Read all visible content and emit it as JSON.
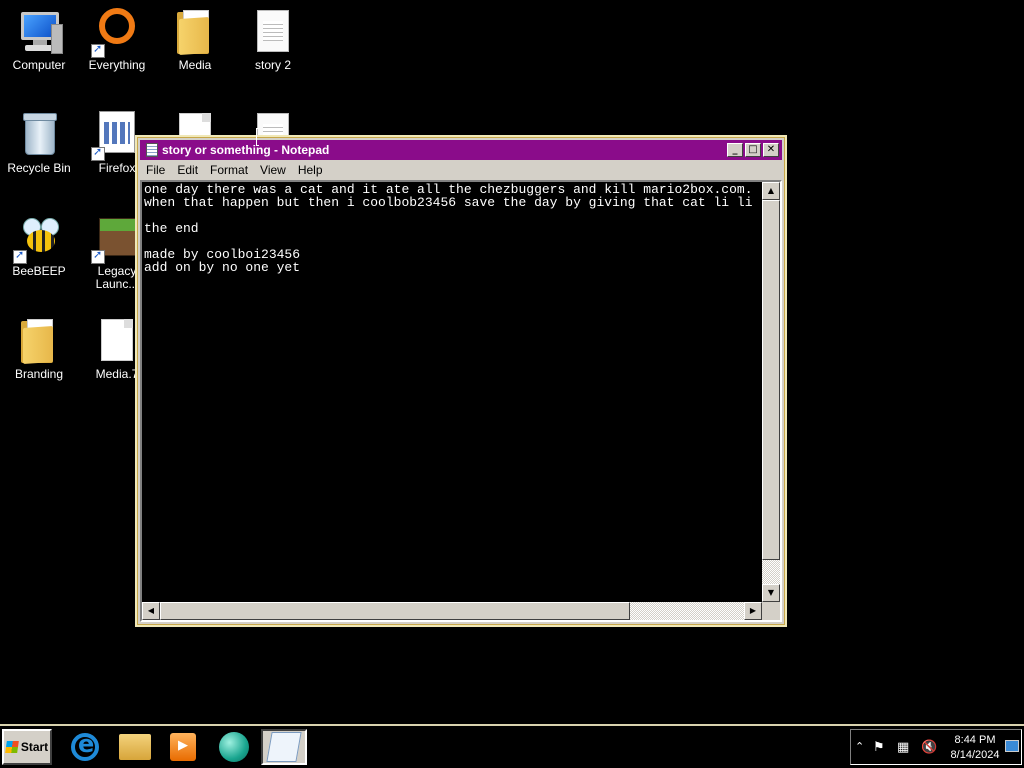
{
  "desktop": {
    "icons": [
      {
        "label": "Computer",
        "icon": "computer-icon"
      },
      {
        "label": "Everything",
        "icon": "everything-icon"
      },
      {
        "label": "Media",
        "icon": "folder-icon"
      },
      {
        "label": "story 2",
        "icon": "text-document-icon"
      },
      {
        "label": "Recycle Bin",
        "icon": "recycle-bin-icon"
      },
      {
        "label": "Firefox",
        "icon": "firefox-shortcut-icon"
      },
      {
        "label": "BeeBEEP",
        "icon": "beebeep-icon"
      },
      {
        "label": "Legacy Launc...",
        "icon": "minecraft-grass-block-icon"
      },
      {
        "label": "Branding",
        "icon": "folder-icon"
      },
      {
        "label": "Media.7",
        "icon": "blank-file-icon"
      }
    ]
  },
  "notepad": {
    "title": "story or something - Notepad",
    "menu": [
      "File",
      "Edit",
      "Format",
      "View",
      "Help"
    ],
    "buttons": {
      "minimize": "_",
      "maximize": "□",
      "close": "✕"
    },
    "content": "one day there was a cat and it ate all the chezbuggers and kill mario2box.com.\nwhen that happen but then i coolbob23456 save the day by giving that cat li li\n\nthe end\n\nmade by coolboi23456\nadd on by no one yet",
    "colors": {
      "titlebar": "#8a0c8a",
      "editor_bg": "#000000",
      "editor_text": "#ffffff"
    }
  },
  "taskbar": {
    "start_label": "Start",
    "pinned": [
      {
        "name": "internet-explorer",
        "icon": "internet-explorer-icon"
      },
      {
        "name": "file-explorer",
        "icon": "folder-icon"
      },
      {
        "name": "media-player",
        "icon": "media-player-icon"
      },
      {
        "name": "teal-app",
        "icon": "teal-globe-icon"
      },
      {
        "name": "notepad",
        "icon": "notepad-icon",
        "active": true
      }
    ],
    "tray": {
      "icons": [
        "show-hidden-icons-chevron",
        "action-center-flag-icon",
        "network-icon",
        "volume-muted-icon"
      ],
      "time": "8:44 PM",
      "date": "8/14/2024"
    }
  }
}
